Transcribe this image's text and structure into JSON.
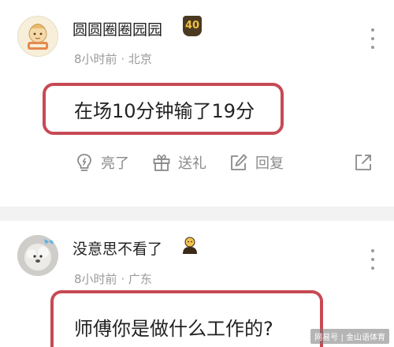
{
  "comments": [
    {
      "username": "圆圆圈圈园园",
      "level": "40",
      "time": "8小时前",
      "location": "北京",
      "text": "在场10分钟输了19分",
      "actions": {
        "like": "亮了",
        "gift": "送礼",
        "reply": "回复"
      }
    },
    {
      "username": "没意思不看了",
      "time": "8小时前",
      "location": "广东",
      "text": "师傅你是做什么工作的?"
    }
  ],
  "meta_separator": " · ",
  "watermark": "网易号 | 金山语体育",
  "colors": {
    "highlight": "#c64a54",
    "meta_text": "#9a9a9a",
    "badge_bg": "#4a3a22",
    "badge_text": "#f0c040"
  }
}
